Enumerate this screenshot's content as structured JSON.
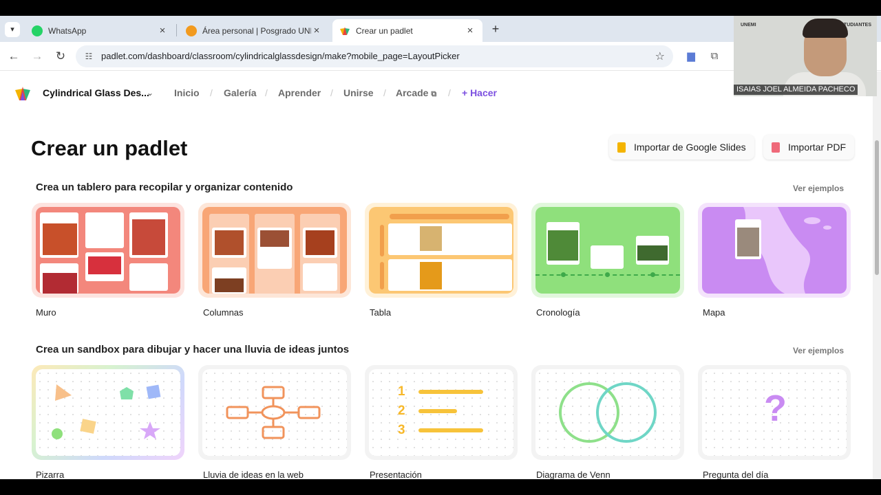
{
  "tabs": [
    {
      "title": "WhatsApp",
      "icon": "whatsapp-icon"
    },
    {
      "title": "Área personal | Posgrado UNEMI",
      "icon": "moodle-icon"
    },
    {
      "title": "Crear un padlet",
      "icon": "padlet-icon"
    }
  ],
  "address_bar": {
    "url": "padlet.com/dashboard/classroom/cylindricalglassdesign/make?mobile_page=LayoutPicker"
  },
  "nav": {
    "workspace": "Cylindrical Glass Des...",
    "links": [
      "Inicio",
      "Galería",
      "Aprender",
      "Unirse",
      "Arcade"
    ],
    "make": "+ Hacer"
  },
  "page": {
    "title": "Crear un padlet",
    "import_slides": "Importar de Google Slides",
    "import_pdf": "Importar PDF"
  },
  "sections": [
    {
      "title": "Crea un tablero para recopilar y organizar contenido",
      "see_examples": "Ver ejemplos",
      "cards": [
        "Muro",
        "Columnas",
        "Tabla",
        "Cronología",
        "Mapa"
      ]
    },
    {
      "title": "Crea un sandbox para dibujar y hacer una lluvia de ideas juntos",
      "see_examples": "Ver ejemplos",
      "cards": [
        "Pizarra",
        "Lluvia de ideas en la web",
        "Presentación",
        "Diagrama de Venn",
        "Pregunta del día"
      ]
    }
  ],
  "presentation_numbers": [
    "1",
    "2",
    "3"
  ],
  "webcam": {
    "name": "ISAIAS JOEL ALMEIDA PACHECO",
    "sign_left": "UNEMI",
    "sign_right": "ESTUDIANTES"
  },
  "colors": {
    "accent": "#7b4fe0",
    "muro": "#f3877c",
    "columnas": "#f8a676",
    "tabla": "#fcc773",
    "cronologia": "#8fe07c",
    "mapa": "#c98bf2"
  }
}
